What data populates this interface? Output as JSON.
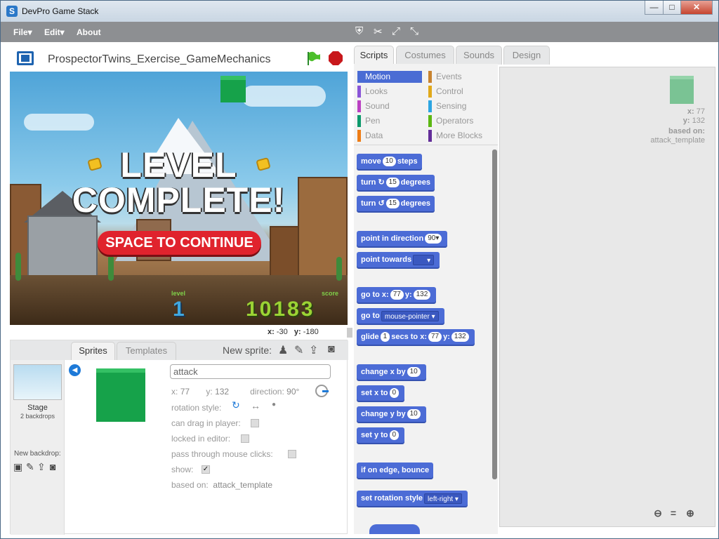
{
  "window": {
    "title": "DevPro Game Stack",
    "app_icon": "S",
    "minimize": "—",
    "maximize": "□",
    "close": "✕"
  },
  "menu": {
    "file": "File▾",
    "edit": "Edit▾",
    "about": "About",
    "tools": [
      "stamp-icon",
      "cut-icon",
      "grow-icon",
      "shrink-icon"
    ]
  },
  "stage": {
    "project_title": "ProspectorTwins_Exercise_GameMechanics",
    "game": {
      "line1": "LEVEL",
      "line2": "COMPLETE!",
      "continue": "SPACE TO CONTINUE",
      "level_label": "level",
      "level_value": "1",
      "score_label": "score",
      "score_value": "10183"
    },
    "coords": {
      "x_label": "x:",
      "x": "-30",
      "y_label": "y:",
      "y": "-180"
    }
  },
  "sprites_pane": {
    "tabs": [
      "Sprites",
      "Templates"
    ],
    "new_sprite": "New sprite:",
    "stage_name": "Stage",
    "stage_backdrops": "2 backdrops",
    "new_backdrop": "New backdrop:",
    "info": {
      "name": "attack",
      "x_label": "x:",
      "x": "77",
      "y_label": "y:",
      "y": "132",
      "direction_label": "direction:",
      "direction": "90°",
      "rotation_style": "rotation style:",
      "can_drag": "can drag in player:",
      "locked": "locked in editor:",
      "pass_through": "pass through mouse clicks:",
      "show": "show:",
      "show_checked": "✓",
      "based_on_label": "based on:",
      "based_on": "attack_template"
    }
  },
  "right_tabs": [
    "Scripts",
    "Costumes",
    "Sounds",
    "Design"
  ],
  "categories": [
    {
      "label": "Motion",
      "color": "#4a6cd4"
    },
    {
      "label": "Events",
      "color": "#c88330"
    },
    {
      "label": "Looks",
      "color": "#8a55d7"
    },
    {
      "label": "Control",
      "color": "#e1a91a"
    },
    {
      "label": "Sound",
      "color": "#bb42c3"
    },
    {
      "label": "Sensing",
      "color": "#2ca5e2"
    },
    {
      "label": "Pen",
      "color": "#0e9a6c"
    },
    {
      "label": "Operators",
      "color": "#5cb712"
    },
    {
      "label": "Data",
      "color": "#ee7d16"
    },
    {
      "label": "More Blocks",
      "color": "#632d99"
    }
  ],
  "blocks": {
    "move": {
      "a": "move",
      "n": "10",
      "b": "steps"
    },
    "turn_cw": {
      "a": "turn",
      "n": "15",
      "b": "degrees"
    },
    "turn_ccw": {
      "a": "turn",
      "n": "15",
      "b": "degrees"
    },
    "point_dir": {
      "a": "point in direction",
      "n": "90▾"
    },
    "point_towards": {
      "a": "point towards",
      "d": "▾"
    },
    "goto_xy": {
      "a": "go to x:",
      "x": "77",
      "b": "y:",
      "y": "132"
    },
    "goto": {
      "a": "go to",
      "d": "mouse-pointer ▾"
    },
    "glide": {
      "a": "glide",
      "s": "1",
      "b": "secs to x:",
      "x": "77",
      "c": "y:",
      "y": "132"
    },
    "change_x": {
      "a": "change x by",
      "n": "10"
    },
    "set_x": {
      "a": "set x to",
      "n": "0"
    },
    "change_y": {
      "a": "change y by",
      "n": "10"
    },
    "set_y": {
      "a": "set y to",
      "n": "0"
    },
    "bounce": {
      "a": "if on edge, bounce"
    },
    "rot_style": {
      "a": "set rotation style",
      "d": "left-right ▾"
    }
  },
  "scripts_area": {
    "x_label": "x:",
    "x": "77",
    "y_label": "y:",
    "y": "132",
    "based_on_label": "based on:",
    "based_on": "attack_template"
  }
}
